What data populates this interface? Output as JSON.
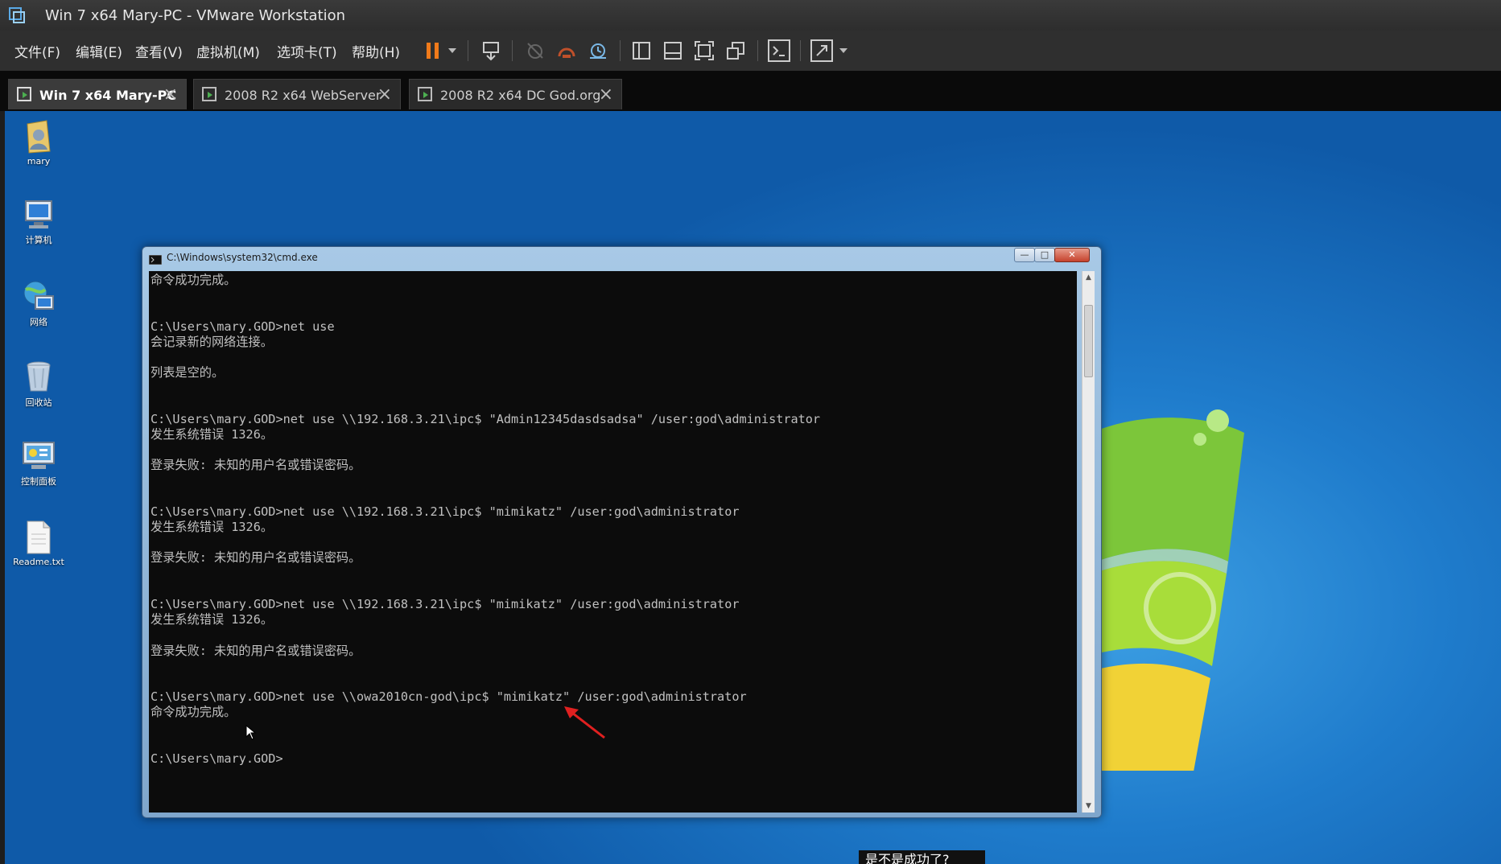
{
  "window": {
    "title": "Win 7 x64 Mary-PC - VMware Workstation"
  },
  "menu": [
    "文件(F)",
    "编辑(E)",
    "查看(V)",
    "虚拟机(M)",
    "选项卡(T)",
    "帮助(H)"
  ],
  "toolbar": [
    "pause-icon",
    "dropdown-icon",
    "send-ctrl-alt-del-icon",
    "snapshot-icon",
    "revert-snapshot-icon",
    "snapshot-manager-icon",
    "view-library-icon",
    "view-thumbnail-icon",
    "full-screen-icon",
    "unity-icon",
    "console-icon",
    "stretch-icon"
  ],
  "tabs": [
    {
      "label": "Win 7 x64 Mary-PC",
      "active": true
    },
    {
      "label": "2008 R2 x64 WebServer",
      "active": false
    },
    {
      "label": "2008 R2 x64 DC God.org",
      "active": false
    }
  ],
  "desktop_icons": [
    {
      "label": "mary",
      "icon": "user-folder-icon"
    },
    {
      "label": "计算机",
      "icon": "computer-icon"
    },
    {
      "label": "网络",
      "icon": "network-icon"
    },
    {
      "label": "回收站",
      "icon": "recycle-bin-icon"
    },
    {
      "label": "控制面板",
      "icon": "control-panel-icon"
    },
    {
      "label": "Readme.txt",
      "icon": "text-file-icon"
    }
  ],
  "cmd": {
    "title": "C:\\Windows\\system32\\cmd.exe",
    "lines": [
      "命令成功完成。",
      "",
      "",
      "C:\\Users\\mary.GOD>net use",
      "会记录新的网络连接。",
      "",
      "列表是空的。",
      "",
      "",
      "C:\\Users\\mary.GOD>net use \\\\192.168.3.21\\ipc$ \"Admin12345dasdsadsa\" /user:god\\administrator",
      "发生系统错误 1326。",
      "",
      "登录失败: 未知的用户名或错误密码。",
      "",
      "",
      "C:\\Users\\mary.GOD>net use \\\\192.168.3.21\\ipc$ \"mimikatz\" /user:god\\administrator",
      "发生系统错误 1326。",
      "",
      "登录失败: 未知的用户名或错误密码。",
      "",
      "",
      "C:\\Users\\mary.GOD>net use \\\\192.168.3.21\\ipc$ \"mimikatz\" /user:god\\administrator",
      "发生系统错误 1326。",
      "",
      "登录失败: 未知的用户名或错误密码。",
      "",
      "",
      "C:\\Users\\mary.GOD>net use \\\\owa2010cn-god\\ipc$ \"mimikatz\" /user:god\\administrator",
      "命令成功完成。",
      "",
      "",
      "C:\\Users\\mary.GOD>"
    ]
  },
  "subtitle": "是不是成功了?",
  "colors": {
    "arrow": "#e02020",
    "console_bg": "#0c0c0c",
    "console_text": "#c0c0c0"
  }
}
